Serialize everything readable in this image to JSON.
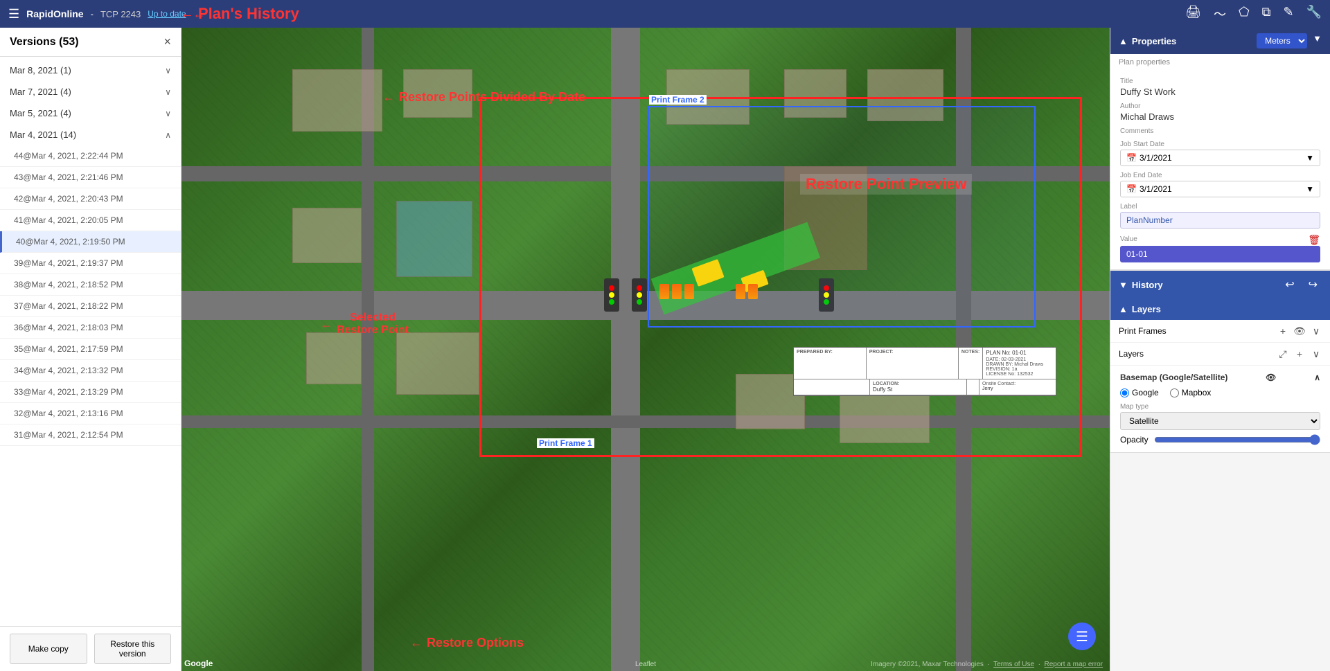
{
  "app": {
    "title": "RapidOnline",
    "plan_id": "TCP 2243",
    "up_to_date": "Up to date",
    "plans_history_arrow_label": "Plan's History"
  },
  "topbar_icons": [
    "print",
    "chart",
    "pentagon",
    "copy",
    "edit",
    "wrench"
  ],
  "sidebar": {
    "title": "Versions (53)",
    "close_label": "×",
    "restore_points_label": "Restore Points Divided By Date",
    "selected_restore_label": "Selected\nRestore Point",
    "restore_options_label": "Restore Options",
    "date_groups": [
      {
        "label": "Mar 8, 2021 (1)",
        "expanded": false
      },
      {
        "label": "Mar 7, 2021 (4)",
        "expanded": false
      },
      {
        "label": "Mar 5, 2021 (4)",
        "expanded": false
      },
      {
        "label": "Mar 4, 2021 (14)",
        "expanded": true,
        "items": [
          {
            "id": "44",
            "label": "44@Mar 4, 2021, 2:22:44 PM",
            "selected": false
          },
          {
            "id": "43",
            "label": "43@Mar 4, 2021, 2:21:46 PM",
            "selected": false
          },
          {
            "id": "42",
            "label": "42@Mar 4, 2021, 2:20:43 PM",
            "selected": false
          },
          {
            "id": "41",
            "label": "41@Mar 4, 2021, 2:20:05 PM",
            "selected": false
          },
          {
            "id": "40",
            "label": "40@Mar 4, 2021, 2:19:50 PM",
            "selected": true
          },
          {
            "id": "39",
            "label": "39@Mar 4, 2021, 2:19:37 PM",
            "selected": false
          },
          {
            "id": "38",
            "label": "38@Mar 4, 2021, 2:18:52 PM",
            "selected": false
          },
          {
            "id": "37",
            "label": "37@Mar 4, 2021, 2:18:22 PM",
            "selected": false
          },
          {
            "id": "36",
            "label": "36@Mar 4, 2021, 2:18:03 PM",
            "selected": false
          },
          {
            "id": "35",
            "label": "35@Mar 4, 2021, 2:17:59 PM",
            "selected": false
          },
          {
            "id": "34",
            "label": "34@Mar 4, 2021, 2:13:32 PM",
            "selected": false
          },
          {
            "id": "33",
            "label": "33@Mar 4, 2021, 2:13:29 PM",
            "selected": false
          },
          {
            "id": "32",
            "label": "32@Mar 4, 2021, 2:13:16 PM",
            "selected": false
          },
          {
            "id": "31",
            "label": "31@Mar 4, 2021, 2:12:54 PM",
            "selected": false
          }
        ]
      }
    ],
    "footer_buttons": [
      {
        "id": "make_copy",
        "label": "Make copy"
      },
      {
        "id": "restore",
        "label": "Restore this version"
      }
    ]
  },
  "map": {
    "restore_preview_label": "Restore Point Preview",
    "print_frame_1": "Print Frame 1",
    "print_frame_2": "Print Frame 2",
    "google_logo": "Google",
    "attribution": "Imagery ©2021, Maxar Technologies",
    "terms": "Terms of Use",
    "report": "Report a map error",
    "leaflet": "Leaflet"
  },
  "title_block": {
    "prepared_by": "PREPARED BY:",
    "project": "PROJECT:",
    "notes": "NOTES:",
    "plan_no": "PLAN No: 01-01",
    "date": "DATE: 02-03-2021",
    "drawn_by": "DRAWN BY: Michal Draws",
    "revision": "REVISION: 1a",
    "license": "LICENSE No: 132532",
    "location": "LOCATION:",
    "location_val": "Duffy St",
    "onsite_contact": "Onsite Contact:",
    "contact_name": "Jerry"
  },
  "right_panel": {
    "properties_label": "Properties",
    "meters_label": "Meters",
    "plan_properties_label": "Plan properties",
    "title_label": "Title",
    "title_value": "Duffy St Work",
    "author_label": "Author",
    "author_value": "Michal Draws",
    "comments_label": "Comments",
    "job_start_label": "Job Start Date",
    "job_start_value": "3/1/2021",
    "job_end_label": "Job End Date",
    "job_end_value": "3/1/2021",
    "label_label": "Label",
    "label_value": "PlanNumber",
    "value_label": "Value",
    "value_value": "01-01",
    "history_label": "History",
    "layers_label": "Layers",
    "print_frames_label": "Print Frames",
    "layers_sub_label": "Layers",
    "basemap_label": "Basemap (Google/Satellite)",
    "radio_google": "Google",
    "radio_mapbox": "Mapbox",
    "map_type_label": "Map type",
    "map_type_value": "Satellite",
    "opacity_label": "Opacity"
  }
}
